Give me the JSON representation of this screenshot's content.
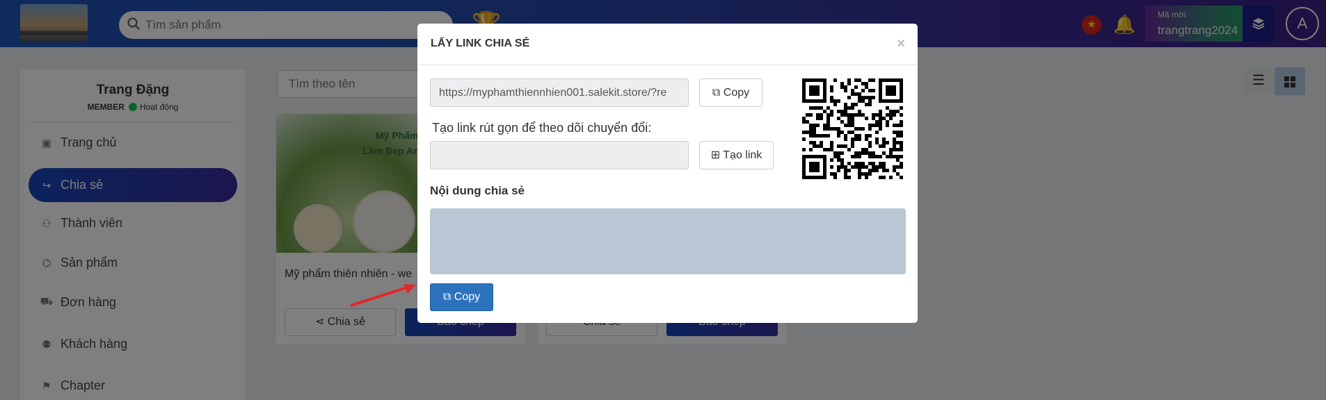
{
  "header": {
    "search_placeholder": "Tìm sản phẩm",
    "ref_label": "Mã mời",
    "ref_code": "trangtrang2024",
    "avatar_letter": "A"
  },
  "sidebar": {
    "user_name": "Trang Đặng",
    "role": "MEMBER",
    "status": "Hoạt động",
    "items": [
      {
        "label": "Trang chủ",
        "icon": "home-image-icon"
      },
      {
        "label": "Chia sẻ",
        "icon": "share-icon",
        "active": true
      },
      {
        "label": "Thành viên",
        "icon": "members-icon"
      },
      {
        "label": "Sản phẩm",
        "icon": "tag-icon"
      },
      {
        "label": "Đơn hàng",
        "icon": "cart-icon"
      },
      {
        "label": "Khách hàng",
        "icon": "customers-icon"
      },
      {
        "label": "Chapter",
        "icon": "chapter-icon"
      }
    ]
  },
  "main": {
    "filter_placeholder": "Tìm theo tên",
    "cards": [
      {
        "image_text_line1": "Mỹ Phẩm Thiê",
        "image_text_line2": "Làm Đẹp An Toàn V",
        "title": "Mỹ phẩm thiên nhiên - we",
        "share_label": "Chia sẻ",
        "report_label": "Báo chép"
      },
      {
        "share_label": "Chia sẻ",
        "report_label": "Báo chép"
      }
    ]
  },
  "modal": {
    "title": "LẤY LINK CHIA SẺ",
    "close": "×",
    "link_value": "https://myphamthiennhien001.salekit.store/?re",
    "copy_label": "Copy",
    "short_link_label": "Tạo link rút gọn để theo dõi chuyển đổi:",
    "create_link_label": "Tạo link",
    "share_content_label": "Nội dung chia sẻ",
    "copy_bottom_label": "Copy"
  },
  "colors": {
    "accent_start": "#1646b8",
    "accent_end": "#3a2c9c",
    "copy_button": "#2d72bd",
    "status_online": "#21c25e",
    "annotation_arrow": "#e3262b"
  }
}
